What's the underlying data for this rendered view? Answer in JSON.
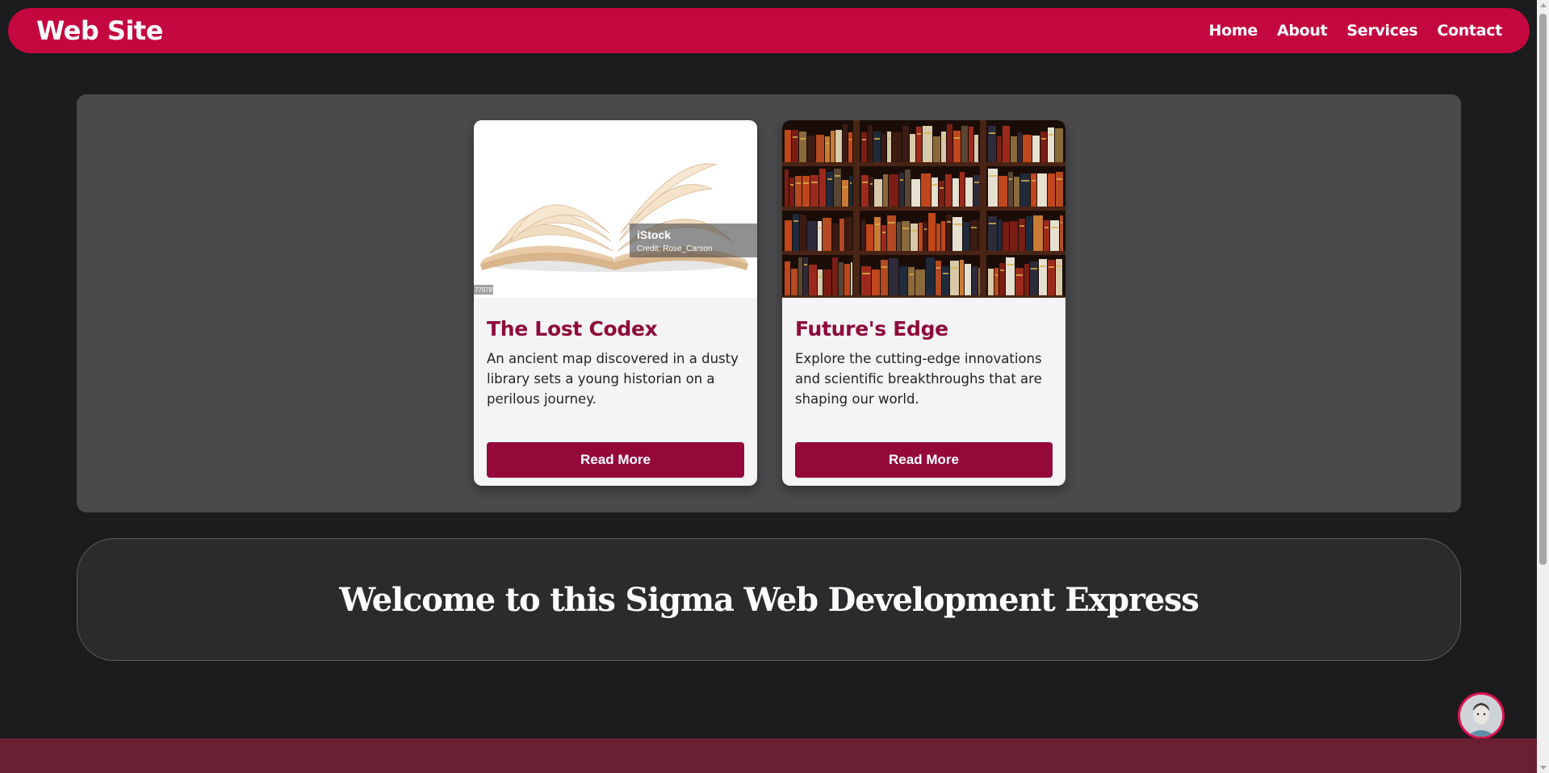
{
  "navbar": {
    "brand": "Web Site",
    "links": [
      "Home",
      "About",
      "Services",
      "Contact"
    ]
  },
  "cards": [
    {
      "title": "The Lost Codex",
      "text": "An ancient map discovered in a dusty library sets a young historian on a perilous journey.",
      "button": "Read More",
      "image": "open-book-photo",
      "watermark": {
        "brand": "iStock",
        "credit": "Credit: Rose_Carson",
        "id": "77978"
      }
    },
    {
      "title": "Future's Edge",
      "text": "Explore the cutting-edge innovations and scientific breakthroughs that are shaping our world.",
      "button": "Read More",
      "image": "bookshelf-photo"
    }
  ],
  "welcome": {
    "title": "Welcome to this Sigma Web Development Express"
  },
  "colors": {
    "primary": "#c4083f",
    "button": "#94083a",
    "card_title": "#8e0a3b",
    "background": "#1c1b1e",
    "footer": "#6a1f33"
  },
  "chat": {
    "icon": "avatar-icon"
  }
}
